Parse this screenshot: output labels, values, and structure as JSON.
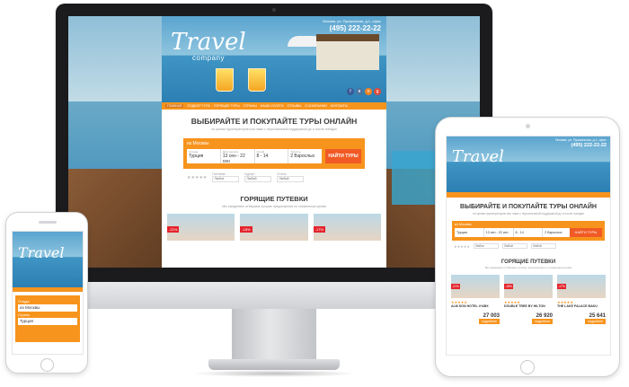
{
  "site": {
    "logo": "Travel",
    "logo_sub": "company",
    "address": "Москва, ул. Пушкинская, д.1, офис",
    "phone": "(495) 222-22-22",
    "nav": [
      "ГЛАВНАЯ",
      "ПОДБОР ТУРА",
      "ГОРЯЩИЕ ТУРЫ",
      "СТРАНЫ",
      "НАШИ УСЛУГИ",
      "ОТЗЫВЫ",
      "О КОМПАНИИ",
      "КОНТАКТЫ"
    ],
    "title": "ВЫБИРАЙТЕ И ПОКУПАЙТЕ ТУРЫ ОНЛАЙН",
    "subtitle": "по ценам туроператоров или ниже с персональной поддержкой до и после поездки",
    "search": {
      "from": "из Москвы",
      "fields": [
        {
          "label": "Страна",
          "value": "Турция"
        },
        {
          "label": "Дата вылета",
          "value": "13 сен - 22 сен"
        },
        {
          "label": "Ночей",
          "value": "8 - 14"
        },
        {
          "label": "Туристы",
          "value": "2 Взрослых"
        }
      ],
      "button": "НАЙТИ ТУРЫ"
    },
    "filters": [
      {
        "label": "Категория",
        "value": "Любой"
      },
      {
        "label": "Питание",
        "value": "Любое"
      },
      {
        "label": "Курорт",
        "value": "Любой"
      },
      {
        "label": "Отель",
        "value": "Любой"
      }
    ],
    "hot_title": "ГОРЯЩИЕ ПУТЕВКИ",
    "hot_sub": "Мы ежедневно отбираем лучшие предложения по сниженным ценам",
    "imac_badges": [
      "-21%",
      "-18%",
      "-17%"
    ]
  },
  "ipad": {
    "cards": [
      {
        "badge": "-21%",
        "name": "ALM SON HOTEL 4*ABX",
        "price": "27 003"
      },
      {
        "badge": "-18%",
        "name": "DOUBLE TREE BY HILTON",
        "price": "26 920"
      },
      {
        "badge": "-17%",
        "name": "THE LAKE PALACE BAKU",
        "price": "25 641"
      }
    ],
    "more": "подробнее"
  },
  "iphone": {
    "from_label": "Откуда",
    "from_value": "из Москвы",
    "country_label": "Страна",
    "country_value": "Турция"
  },
  "colors": {
    "accent": "#f7941d",
    "button": "#f15a24",
    "badge": "#e4242c"
  }
}
